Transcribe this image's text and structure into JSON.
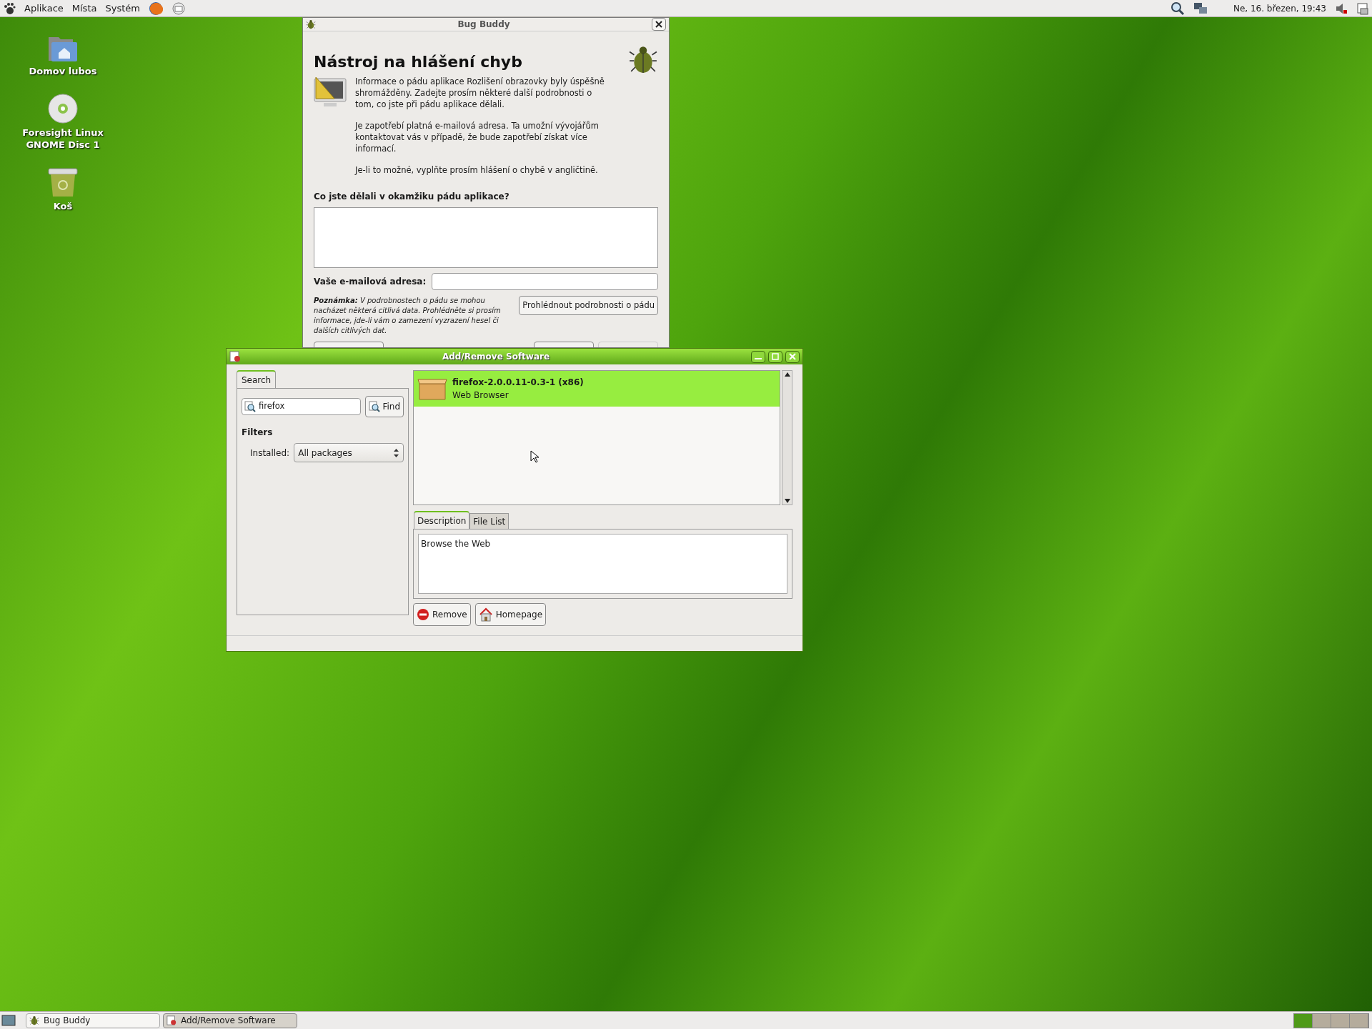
{
  "top_panel": {
    "menus": [
      "Aplikace",
      "Místa",
      "Systém"
    ],
    "clock": "Ne, 16. březen, 19:43"
  },
  "desktop_icons": [
    {
      "label": "Domov lubos",
      "kind": "home"
    },
    {
      "label": "Foresight Linux GNOME Disc 1",
      "kind": "disc"
    },
    {
      "label": "Koš",
      "kind": "trash"
    }
  ],
  "bug_buddy": {
    "title": "Bug Buddy",
    "heading": "Nástroj na hlášení chyb",
    "paragraphs": [
      "Informace o pádu aplikace Rozlišení obrazovky byly úspěšně shromážděny. Zadejte prosím některé další podrobnosti o tom, co jste při pádu aplikace dělali.",
      "Je zapotřebí platná e-mailová adresa. Ta umožní vývojářům kontaktovat vás v případě, že bude zapotřebí získat více informací.",
      "Je-li to možné, vyplňte prosím hlášení o chybě v angličtině."
    ],
    "question_label": "Co jste dělali v okamžiku pádu aplikace?",
    "email_label": "Vaše e-mailová adresa:",
    "note": "**Poznámka:** V podrobnostech o pádu se mohou nacházet některá citlivá data. Prohlédněte si prosím informace, jde-li vám o zamezení vyzrazení hesel či dalších citlivých dat.",
    "details_button": "Prohlédnout podrobnosti o pádu"
  },
  "add_remove": {
    "title": "Add/Remove Software",
    "tabs": [
      {
        "label": "Search",
        "selected": true
      }
    ],
    "search_value": "firefox",
    "find_button": "Find",
    "filters_heading": "Filters",
    "installed_label": "Installed:",
    "installed_value": "All packages",
    "packages": [
      {
        "name": "firefox-2.0.0.11-0.3-1 (x86)",
        "summary": "Web Browser",
        "selected": true
      }
    ],
    "detail_tabs": [
      {
        "label": "Description",
        "selected": true
      },
      {
        "label": "File List",
        "selected": false
      }
    ],
    "description": "Browse the Web",
    "buttons": [
      {
        "label": "Remove",
        "kind": "remove"
      },
      {
        "label": "Homepage",
        "kind": "home"
      }
    ]
  },
  "taskbar": [
    {
      "label": "Bug Buddy",
      "kind": "bug",
      "selected": false
    },
    {
      "label": "Add/Remove Software",
      "kind": "software",
      "selected": true
    }
  ],
  "workspaces": [
    {
      "selected": true
    },
    {
      "selected": false
    },
    {
      "selected": false
    },
    {
      "selected": false
    }
  ]
}
